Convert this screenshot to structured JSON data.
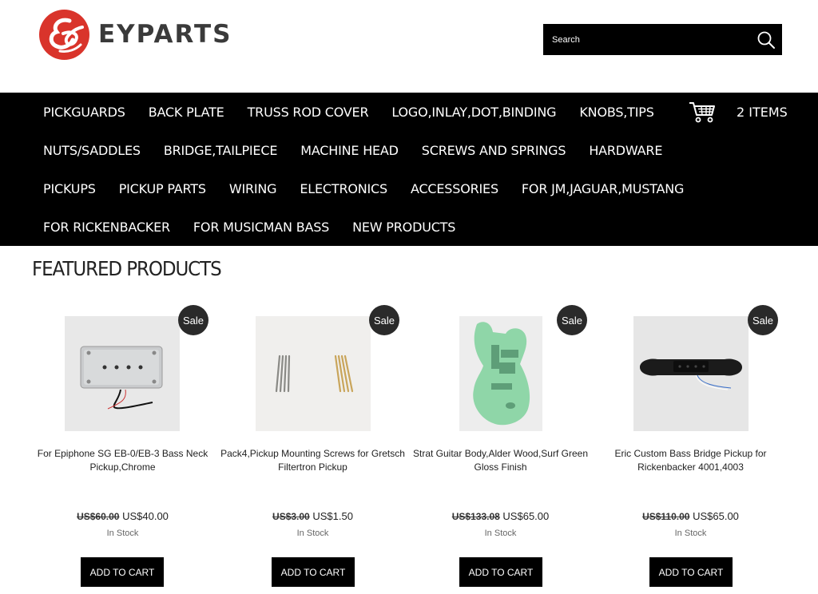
{
  "header": {
    "logo_text": "EYPARTS",
    "search_placeholder": "Search"
  },
  "nav": {
    "rows": [
      [
        "PICKGUARDS",
        "BACK PLATE",
        "TRUSS ROD COVER",
        "LOGO,INLAY,DOT,BINDING",
        "KNOBS,TIPS"
      ],
      [
        "NUTS/SADDLES",
        "BRIDGE,TAILPIECE",
        "MACHINE HEAD",
        "SCREWS AND SPRINGS",
        "HARDWARE"
      ],
      [
        "PICKUPS",
        "PICKUP PARTS",
        "WIRING",
        "ELECTRONICS",
        "ACCESSORIES",
        "FOR JM,JAGUAR,MUSTANG"
      ],
      [
        "FOR RICKENBACKER",
        "FOR MUSICMAN BASS",
        "NEW PRODUCTS"
      ]
    ],
    "cart_label": "2 ITEMS"
  },
  "featured": {
    "title": "FEATURED PRODUCTS",
    "products": [
      {
        "sale_badge": "Sale",
        "name": "For Epiphone SG EB-0/EB-3 Bass Neck Pickup,Chrome",
        "old_price": "US$60.00",
        "new_price": "US$40.00",
        "stock": "In Stock",
        "button": "ADD TO CART"
      },
      {
        "sale_badge": "Sale",
        "name": "Pack4,Pickup Mounting Screws for Gretsch Filtertron Pickup",
        "old_price": "US$3.00",
        "new_price": "US$1.50",
        "stock": "In Stock",
        "button": "ADD TO CART"
      },
      {
        "sale_badge": "Sale",
        "name": "Strat Guitar Body,Alder Wood,Surf Green Gloss Finish",
        "old_price": "US$133.08",
        "new_price": "US$65.00",
        "stock": "In Stock",
        "button": "ADD TO CART"
      },
      {
        "sale_badge": "Sale",
        "name": "Eric Custom Bass Bridge Pickup for Rickenbacker 4001,4003",
        "old_price": "US$110.00",
        "new_price": "US$65.00",
        "stock": "In Stock",
        "button": "ADD TO CART"
      }
    ]
  },
  "colors": {
    "nav_bg": "#000000",
    "logo_red": "#d9342b",
    "sale_badge_bg": "#2a2a2a"
  },
  "icons": {
    "search": "search-icon",
    "cart": "shopping-cart-icon"
  }
}
